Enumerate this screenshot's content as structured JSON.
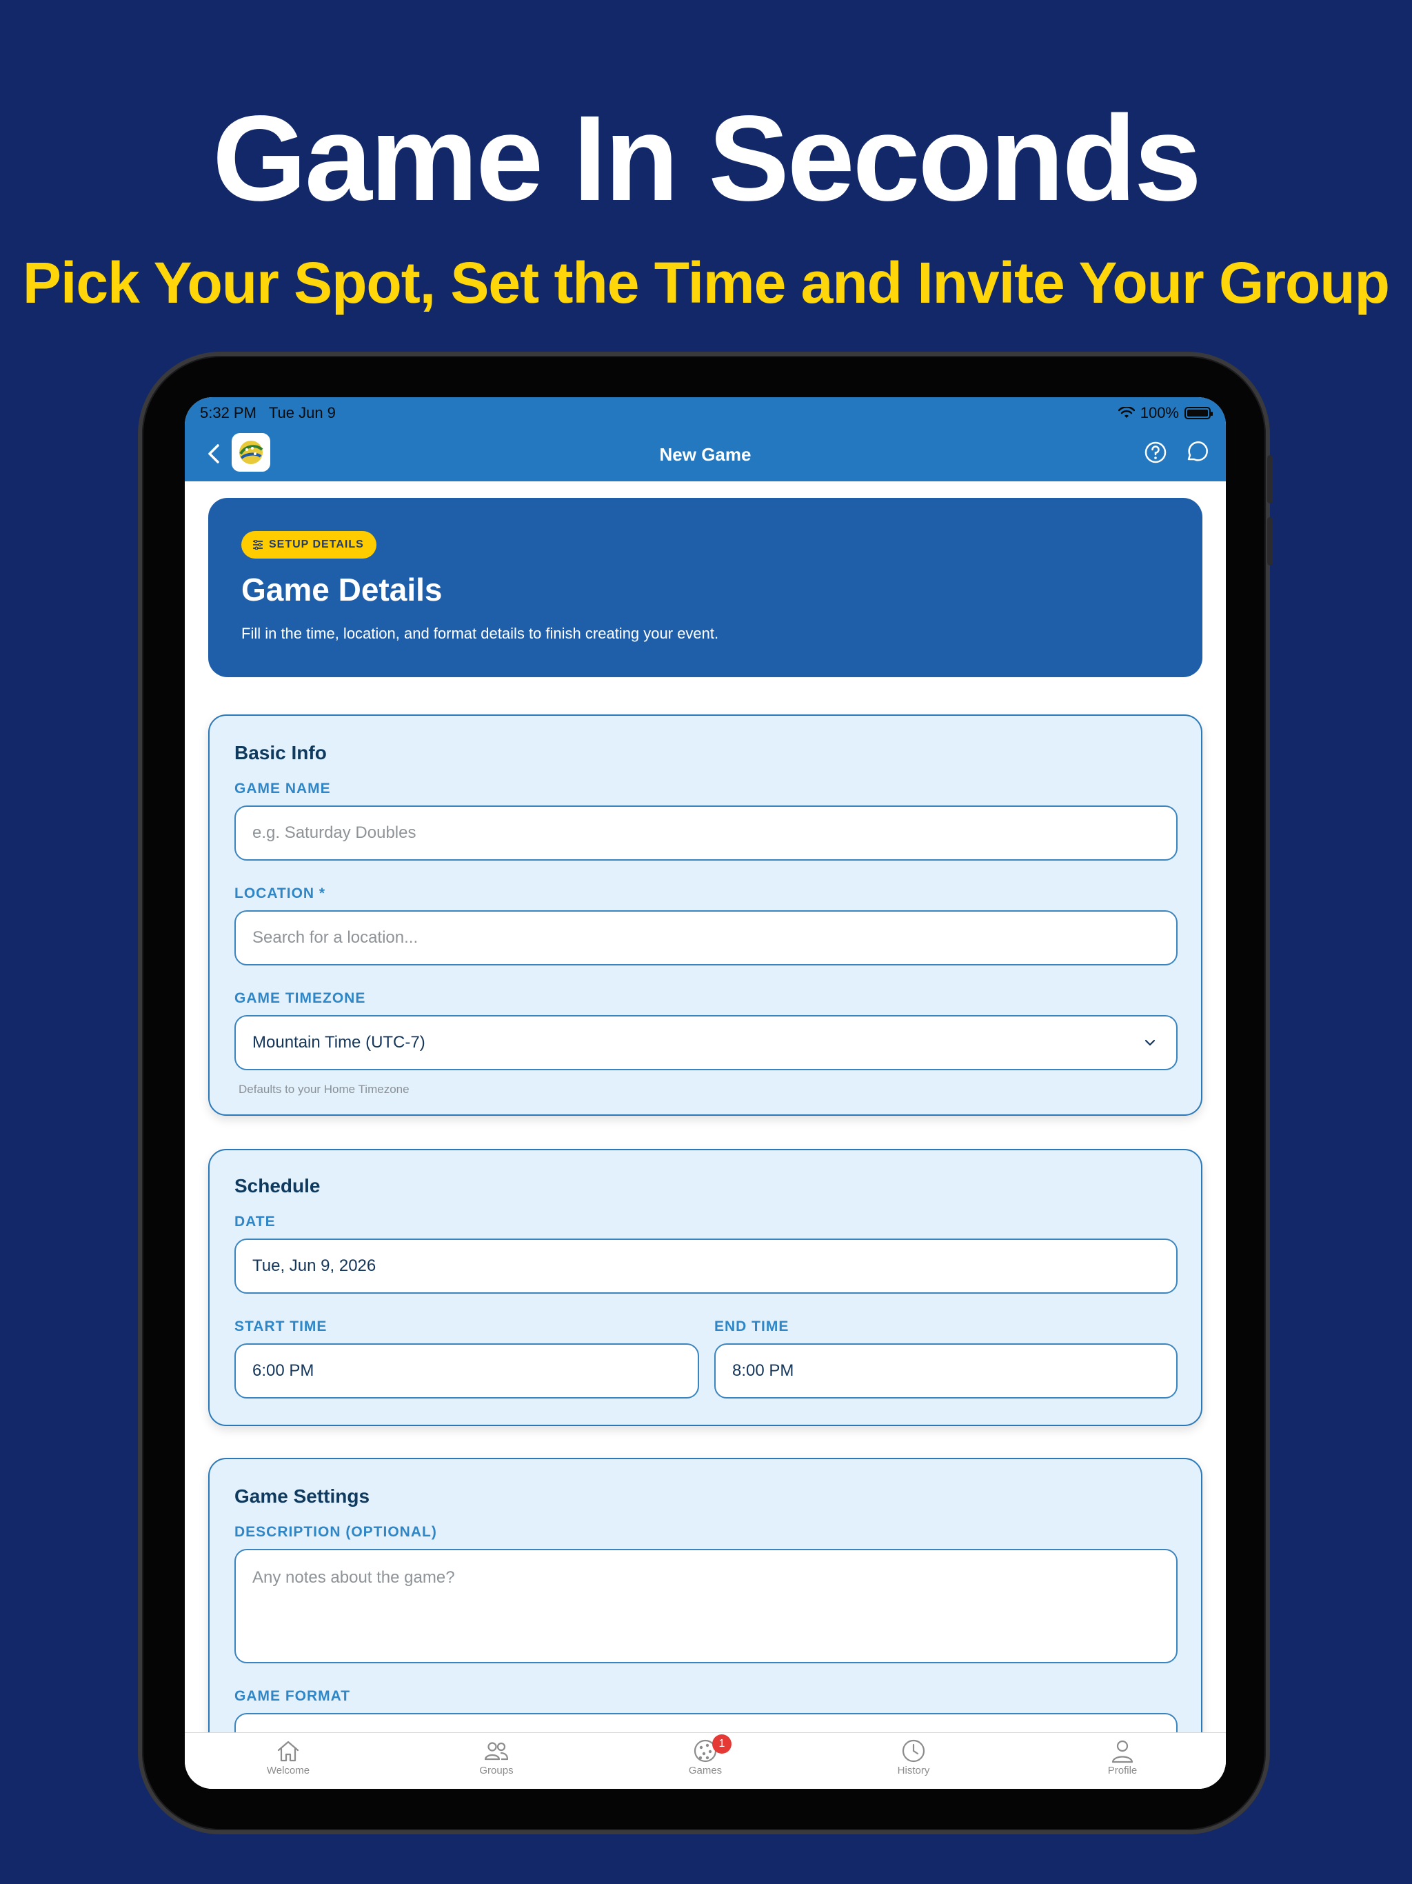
{
  "hero": {
    "title": "Game In Seconds",
    "subtitle": "Pick Your Spot, Set the Time and Invite Your Group"
  },
  "status_bar": {
    "time": "5:32 PM",
    "date": "Tue Jun 9",
    "battery": "100%"
  },
  "nav": {
    "title": "New Game",
    "icons": [
      "chevron-left-icon",
      "app-logo",
      "help-icon",
      "chat-icon"
    ]
  },
  "banner": {
    "pill": "SETUP DETAILS",
    "title": "Game Details",
    "subtitle": "Fill in the time, location, and format details to finish creating your event."
  },
  "basic_info": {
    "title": "Basic Info",
    "game_name_label": "GAME NAME",
    "game_name_placeholder": "e.g. Saturday Doubles",
    "location_label": "LOCATION *",
    "location_placeholder": "Search for a location...",
    "timezone_label": "GAME TIMEZONE",
    "timezone_value": "Mountain Time (UTC-7)",
    "timezone_hint": "Defaults to your Home Timezone"
  },
  "schedule": {
    "title": "Schedule",
    "date_label": "DATE",
    "date_value": "Tue, Jun 9, 2026",
    "start_label": "START TIME",
    "start_value": "6:00 PM",
    "end_label": "END TIME",
    "end_value": "8:00 PM"
  },
  "game_settings": {
    "title": "Game Settings",
    "description_label": "DESCRIPTION (OPTIONAL)",
    "description_placeholder": "Any notes about the game?",
    "format_label": "GAME FORMAT"
  },
  "tabs": [
    {
      "label": "Welcome",
      "icon": "home-icon"
    },
    {
      "label": "Groups",
      "icon": "groups-icon"
    },
    {
      "label": "Games",
      "icon": "pickleball-icon",
      "badge": "1"
    },
    {
      "label": "History",
      "icon": "clock-icon"
    },
    {
      "label": "Profile",
      "icon": "person-icon"
    }
  ],
  "colors": {
    "background": "#132869",
    "accent_yellow": "#FFD60A",
    "nav_blue": "#2378C0",
    "banner_blue": "#1F5FAA",
    "card_bg": "#E3F1FC",
    "label_blue": "#2F86C6",
    "badge_red": "#E53935"
  }
}
